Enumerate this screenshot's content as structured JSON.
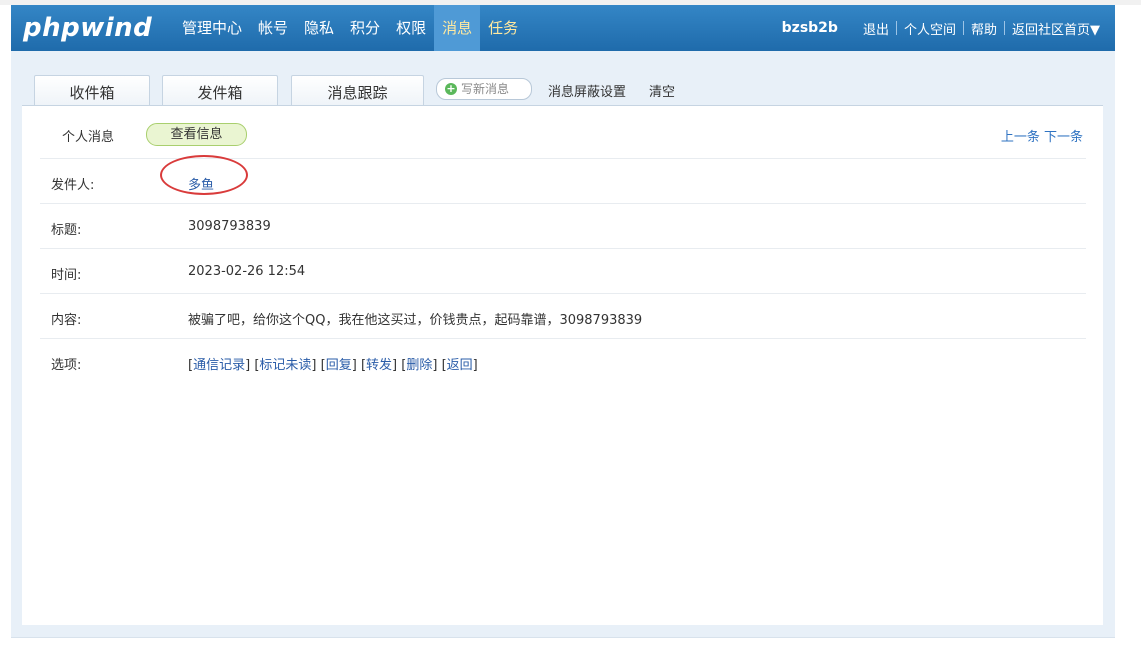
{
  "brand": {
    "logo": "phpwind"
  },
  "nav": {
    "items": [
      {
        "label": "管理中心"
      },
      {
        "label": "帐号"
      },
      {
        "label": "隐私"
      },
      {
        "label": "积分"
      },
      {
        "label": "权限"
      },
      {
        "label": "消息",
        "active": true
      },
      {
        "label": "任务"
      }
    ]
  },
  "user": {
    "name": "bzsb2b",
    "links": [
      "退出",
      "个人空间",
      "帮助",
      "返回社区首页▼"
    ]
  },
  "tabs": [
    {
      "label": "收件箱"
    },
    {
      "label": "发件箱"
    },
    {
      "label": "消息跟踪"
    }
  ],
  "toolbar": {
    "write_label": "写新消息",
    "block_settings": "消息屏蔽设置",
    "clear": "清空"
  },
  "subbar": {
    "personal": "个人消息",
    "view_info": "查看信息",
    "prev": "上一条",
    "next": "下一条"
  },
  "message": {
    "sender_label": "发件人:",
    "sender": "多鱼",
    "title_label": "标题:",
    "title": "3098793839",
    "time_label": "时间:",
    "time": "2023-02-26 12:54",
    "content_label": "内容:",
    "content": "被骗了吧，给你这个QQ，我在他这买过，价钱贵点，起码靠谱，3098793839",
    "options_label": "选项:",
    "options": [
      "通信记录",
      "标记未读",
      "回复",
      "转发",
      "删除",
      "返回"
    ]
  },
  "colors": {
    "topbar": "#2a79bb",
    "link": "#2a5ca8",
    "highlight_circle": "#d93b3b",
    "pill": "#eaf5d2"
  }
}
